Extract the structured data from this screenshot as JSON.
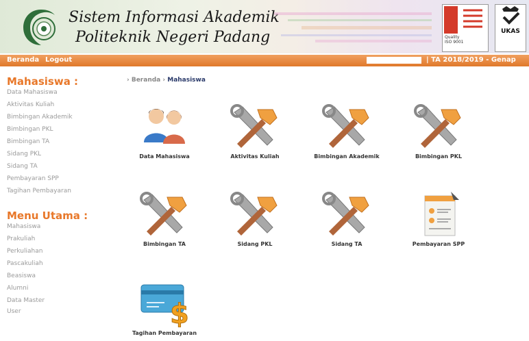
{
  "header": {
    "title_line1": "Sistem Informasi Akademik",
    "title_line2": "Politeknik Negeri Padang",
    "cert_lines": [
      "Quality",
      "ISO 9001"
    ],
    "ukas_label": "UKAS"
  },
  "nav": {
    "home_label": "Beranda",
    "logout_label": "Logout",
    "ta_info": "| TA 2018/2019 - Genap"
  },
  "breadcrumb": {
    "home": "› Beranda ›",
    "current": "Mahasiswa"
  },
  "sidebar": {
    "section1_title": "Mahasiswa :",
    "section1_items": [
      "Data Mahasiswa",
      "Aktivitas Kuliah",
      "Bimbingan Akademik",
      "Bimbingan PKL",
      "Bimbingan TA",
      "Sidang PKL",
      "Sidang TA",
      "Pembayaran SPP",
      "Tagihan Pembayaran"
    ],
    "section2_title": "Menu Utama :",
    "section2_items": [
      "Mahasiswa",
      "Prakuliah",
      "Perkuliahan",
      "Pascakuliah",
      "Beasiswa",
      "Alumni",
      "Data Master",
      "User"
    ]
  },
  "tiles": [
    {
      "label": "Data Mahasiswa",
      "icon": "users-icon"
    },
    {
      "label": "Aktivitas Kuliah",
      "icon": "tools-icon"
    },
    {
      "label": "Bimbingan Akademik",
      "icon": "tools-icon"
    },
    {
      "label": "Bimbingan PKL",
      "icon": "tools-icon"
    },
    {
      "label": "Bimbingan TA",
      "icon": "tools-icon"
    },
    {
      "label": "Sidang PKL",
      "icon": "tools-icon"
    },
    {
      "label": "Sidang TA",
      "icon": "tools-icon"
    },
    {
      "label": "Pembayaran SPP",
      "icon": "document-icon"
    },
    {
      "label": "Tagihan Pembayaran",
      "icon": "payment-card-icon"
    }
  ],
  "colors": {
    "accent": "#e8782a",
    "nav_bar": "#e0782a",
    "breadcrumb_current": "#2a3a6a"
  }
}
